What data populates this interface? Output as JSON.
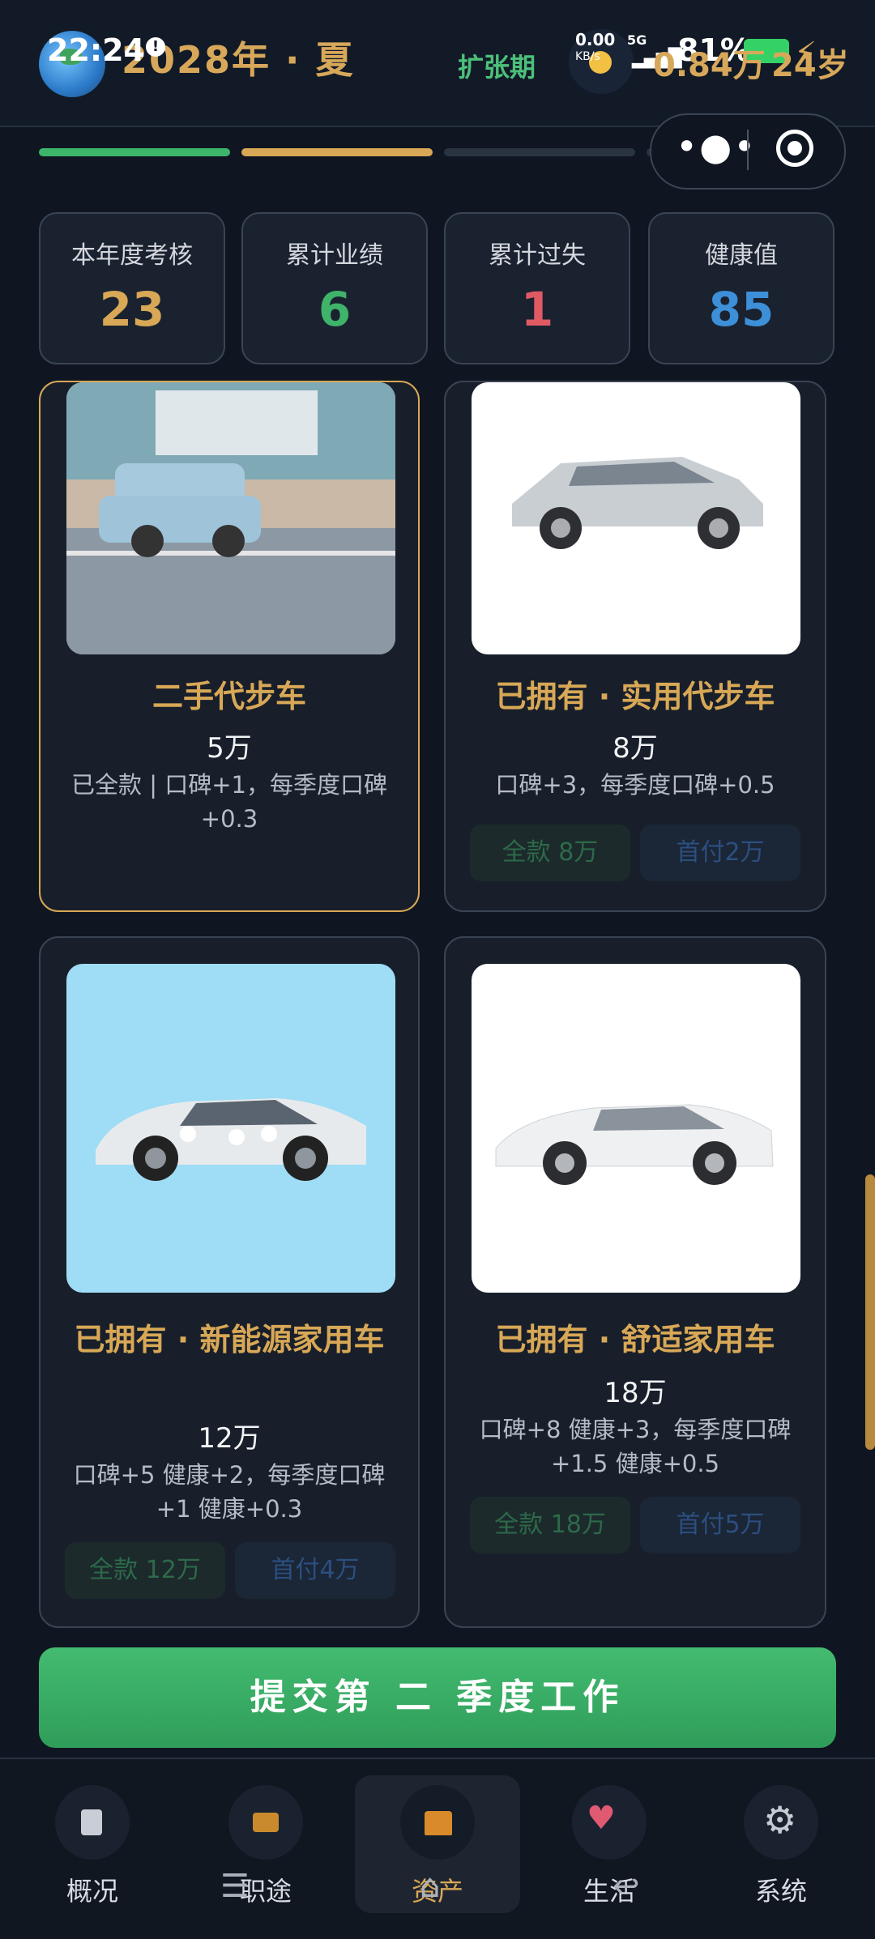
{
  "status_bar": {
    "time": "22:24",
    "network_speed": "0.00",
    "network_unit": "KB/s",
    "network_type": "5G",
    "battery": "81%"
  },
  "header": {
    "year_season": "2028年 · 夏",
    "phase": "扩张期",
    "money": "0.84万",
    "age": "24岁"
  },
  "progress": {
    "segments": [
      {
        "color": "#3cb56a",
        "fill": 1
      },
      {
        "color": "#d8a856",
        "fill": 1
      },
      {
        "color": "#2a3340",
        "fill": 0
      },
      {
        "color": "#2a3340",
        "fill": 0
      }
    ]
  },
  "stats": [
    {
      "label": "本年度考核",
      "value": "23",
      "color": "#d8a856"
    },
    {
      "label": "累计业绩",
      "value": "6",
      "color": "#3fb36a"
    },
    {
      "label": "累计过失",
      "value": "1",
      "color": "#e05a64"
    },
    {
      "label": "健康值",
      "value": "85",
      "color": "#3d8fd8"
    }
  ],
  "assets": [
    {
      "title": "二手代步车",
      "price": "5万",
      "desc": "已全款 | 口碑+1，每季度口碑+0.3",
      "selected": true,
      "buttons": []
    },
    {
      "title": "已拥有 · 实用代步车",
      "price": "8万",
      "desc": "口碑+3，每季度口碑+0.5",
      "buttons": [
        "全款 8万",
        "首付2万"
      ]
    },
    {
      "title": "已拥有 · 新能源家用车",
      "price": "12万",
      "desc": "口碑+5 健康+2，每季度口碑+1 健康+0.3",
      "buttons": [
        "全款 12万",
        "首付4万"
      ]
    },
    {
      "title": "已拥有 · 舒适家用车",
      "price": "18万",
      "desc": "口碑+8 健康+3，每季度口碑+1.5 健康+0.5",
      "buttons": [
        "全款 18万",
        "首付5万"
      ]
    }
  ],
  "submit": {
    "label": "提交第 二 季度工作"
  },
  "nav": [
    {
      "label": "概况",
      "icon": "clipboard-icon"
    },
    {
      "label": "职途",
      "icon": "briefcase-icon"
    },
    {
      "label": "资产",
      "icon": "house-icon",
      "active": true
    },
    {
      "label": "生活",
      "icon": "heart-icon"
    },
    {
      "label": "系统",
      "icon": "gear-icon"
    }
  ]
}
